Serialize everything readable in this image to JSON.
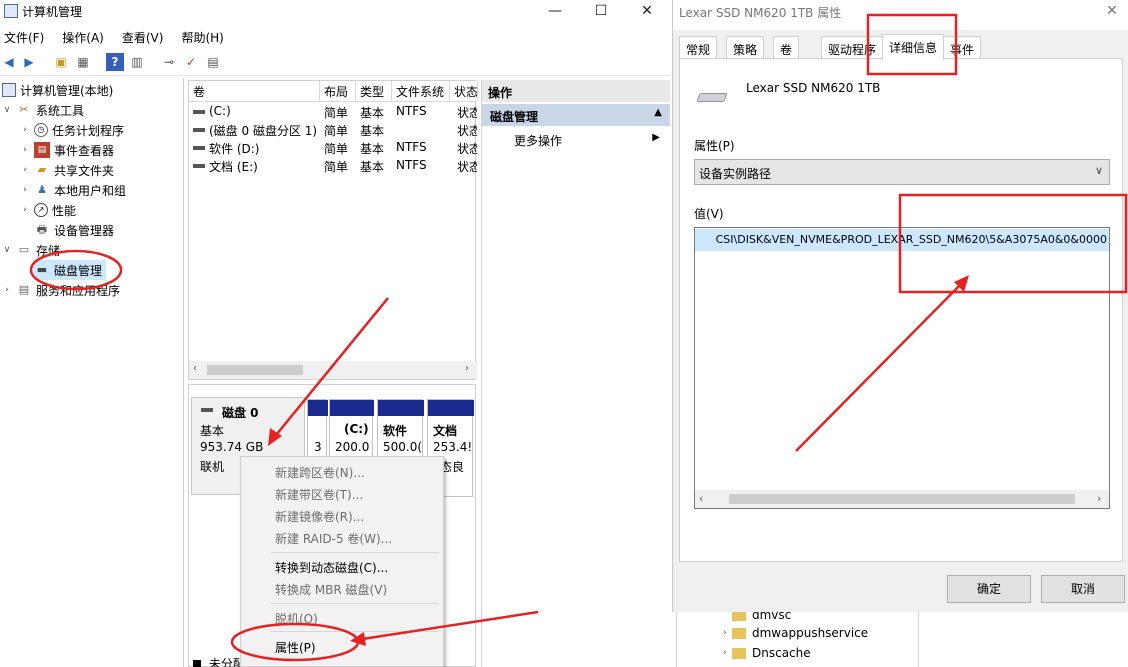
{
  "left_window": {
    "title": "计算机管理",
    "controls": {
      "minimize": "—",
      "maximize": "☐",
      "close": "✕"
    },
    "menu": [
      "文件(F)",
      "操作(A)",
      "查看(V)",
      "帮助(H)"
    ],
    "tree": {
      "root": "计算机管理(本地)",
      "system_tools": "系统工具",
      "system_children": [
        "任务计划程序",
        "事件查看器",
        "共享文件夹",
        "本地用户和组",
        "性能",
        "设备管理器"
      ],
      "storage": "存储",
      "disk_mgmt": "磁盘管理",
      "services": "服务和应用程序"
    },
    "volume_table": {
      "headers": [
        "卷",
        "布局",
        "类型",
        "文件系统",
        "状态"
      ],
      "rows": [
        [
          "(C:)",
          "简单",
          "基本",
          "NTFS",
          "状态"
        ],
        [
          "(磁盘 0 磁盘分区 1)",
          "简单",
          "基本",
          "",
          "状态"
        ],
        [
          "软件 (D:)",
          "简单",
          "基本",
          "NTFS",
          "状态"
        ],
        [
          "文档 (E:)",
          "简单",
          "基本",
          "NTFS",
          "状态"
        ]
      ]
    },
    "disk": {
      "name": "磁盘 0",
      "type": "基本",
      "size": "953.74 GB",
      "status": "联机",
      "partitions": [
        {
          "label": "3",
          "size": ""
        },
        {
          "label": "(C:)",
          "size": "200.0"
        },
        {
          "label": "软件",
          "size": "500.0("
        },
        {
          "label": "文档",
          "size": "253.4!"
        }
      ],
      "partition_status": "态良",
      "bottom_legend": "未分配"
    },
    "actions_panel": {
      "header": "操作",
      "section": "磁盘管理",
      "more": "更多操作"
    },
    "context_menu": {
      "items": [
        {
          "label": "新建跨区卷(N)...",
          "enabled": false
        },
        {
          "label": "新建带区卷(T)...",
          "enabled": false
        },
        {
          "label": "新建镜像卷(R)...",
          "enabled": false
        },
        {
          "label": "新建 RAID-5 卷(W)...",
          "enabled": false
        },
        {
          "label": "转换到动态磁盘(C)...",
          "enabled": true
        },
        {
          "label": "转换成 MBR 磁盘(V)",
          "enabled": false
        },
        {
          "label": "脱机(O)",
          "enabled": false
        },
        {
          "label": "属性(P)",
          "enabled": true
        }
      ]
    }
  },
  "right_window": {
    "title": "Lexar SSD NM620 1TB 属性",
    "close": "✕",
    "tabs": [
      "常规",
      "策略",
      "卷",
      "驱动程序",
      "详细信息",
      "事件"
    ],
    "active_tab": "详细信息",
    "device_name": "Lexar SSD NM620 1TB",
    "property_label": "属性(P)",
    "property_value": "设备实例路径",
    "value_label": "值(V)",
    "value_text": "CSI\\DISK&VEN_NVME&PROD_LEXAR_SSD_NM620\\5&A3075A0&0&0000",
    "ok": "确定",
    "cancel": "取消"
  },
  "background_list": {
    "items": [
      "dmvsc",
      "dmwappushservice",
      "Dnscache"
    ]
  },
  "colors": {
    "selection_blue": "#cce8ff",
    "partition_header": "#1b2a8f",
    "annotation_red": "#e32323",
    "actions_header": "#e8e8e8",
    "actions_section": "#c9d6e8"
  }
}
